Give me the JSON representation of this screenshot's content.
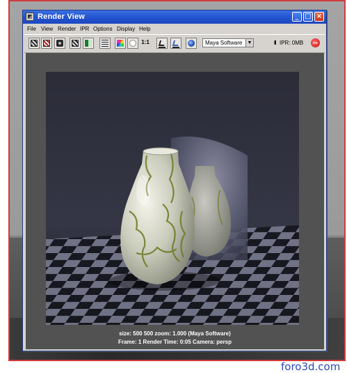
{
  "window": {
    "title": "Render View"
  },
  "menu": [
    "File",
    "View",
    "Render",
    "IPR",
    "Options",
    "Display",
    "Help"
  ],
  "toolbar": {
    "icons": [
      "redo-render-icon",
      "render-region-icon",
      "snapshot-icon",
      "refresh-ipr-icon",
      "display-channels-icon",
      "adjust-image-icon",
      "display-rgb-icon",
      "display-alpha-icon",
      "real-size-icon",
      "keep-image-icon",
      "remove-image-icon",
      "render-settings-icon"
    ],
    "ratio_label": "1:1",
    "renderer": "Maya Software",
    "ipr_pause": "II",
    "ipr_label": "IPR: 0MB",
    "ipr_stop": "IPR"
  },
  "status": {
    "line1": "size:  500  500 zoom: 1.000        (Maya Software)",
    "line2": "Frame: 1      Render Time: 0:05      Camera: persp"
  },
  "watermark": "foro3d.com",
  "colors": {
    "titlebar": "#2454d0",
    "frame": "#d23a3a",
    "render_background": "#525252"
  }
}
